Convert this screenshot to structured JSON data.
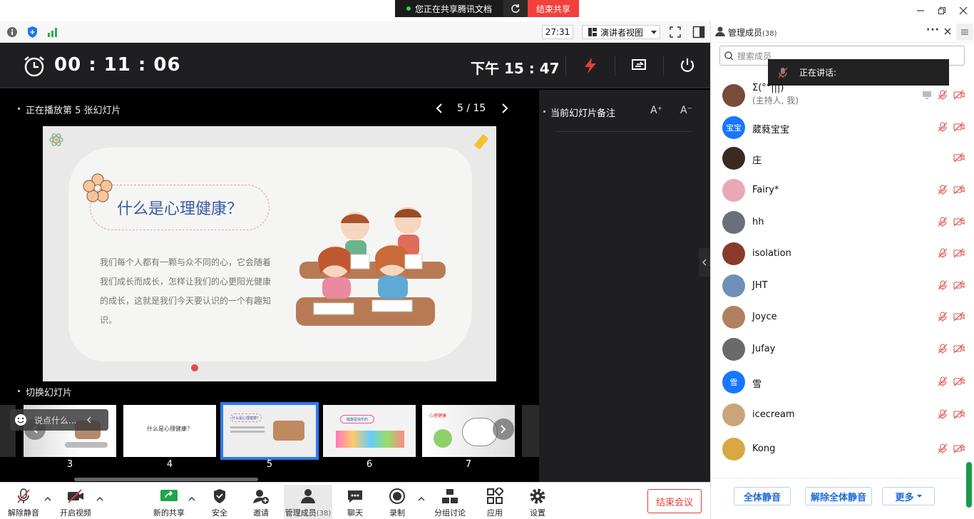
{
  "share_bar": {
    "status": "您正在共享腾讯文档",
    "end_share": "结束共享"
  },
  "info_bar": {
    "duration": "27:31",
    "view_mode": "演讲者视图"
  },
  "presenter": {
    "elapsed": "00 : 11 : 06",
    "clock": "下午 15 : 47",
    "now_playing": "正在播放第 5 张幻灯片",
    "page": "5 / 15",
    "notes_title": "当前幻灯片备注",
    "font_up": "A⁺",
    "font_down": "A⁻",
    "switch_title": "切换幻灯片",
    "slide": {
      "title": "什么是心理健康？",
      "body": "我们每个人都有一颗与众不同的心，它会随着我们成长而成长，怎样让我们的心更阳光健康的成长，这就是我们今天要认识的一个有趣知识。"
    },
    "chat_placeholder": "说点什么...",
    "thumbnails": [
      {
        "num": "3"
      },
      {
        "num": "4",
        "text": "什么是心理健康？"
      },
      {
        "num": "5",
        "text": "什么是心理健康？",
        "selected": true
      },
      {
        "num": "6",
        "text": "健康是快乐的"
      },
      {
        "num": "7",
        "text": "心理健康"
      }
    ]
  },
  "toolbar": {
    "unmute": "解除静音",
    "video": "开启视频",
    "share": "新的共享",
    "security": "安全",
    "invite": "邀请",
    "members": "管理成员",
    "members_count": "(38)",
    "chat": "聊天",
    "record": "录制",
    "breakout": "分组讨论",
    "apps": "应用",
    "settings": "设置",
    "end_meeting": "结束会议"
  },
  "panel": {
    "title": "管理成员",
    "count": "(38)",
    "search_placeholder": "搜索成员",
    "speaking": "正在讲话:",
    "members": [
      {
        "name": "Σ(°°|||)",
        "sub": "(主持人, 我)",
        "avatar": "#7a4a3a"
      },
      {
        "name": "葳蕤宝宝",
        "avatar": "#1677ff",
        "avatar_text": "宝宝"
      },
      {
        "name": "庄",
        "avatar": "#3b2a20"
      },
      {
        "name": "Fairy*",
        "avatar": "#e9a8b8"
      },
      {
        "name": "hh",
        "avatar": "#6b6f7a"
      },
      {
        "name": "isolation",
        "avatar": "#8a3a2a"
      },
      {
        "name": "JHT",
        "avatar": "#6f8fb8"
      },
      {
        "name": "Joyce",
        "avatar": "#b08060"
      },
      {
        "name": "Jufay",
        "avatar": "#6a6a6a"
      },
      {
        "name": "雪",
        "avatar": "#1677ff",
        "avatar_text": "雪"
      },
      {
        "name": "icecream",
        "avatar": "#c9a57a"
      },
      {
        "name": "Kong",
        "avatar": "#d7a843"
      }
    ],
    "mute_all": "全体静音",
    "unmute_all": "解除全体静音",
    "more": "更多"
  },
  "colors": {
    "accent": "#1677ff",
    "danger": "#f2403c",
    "muted_icon": "#e0524c"
  }
}
